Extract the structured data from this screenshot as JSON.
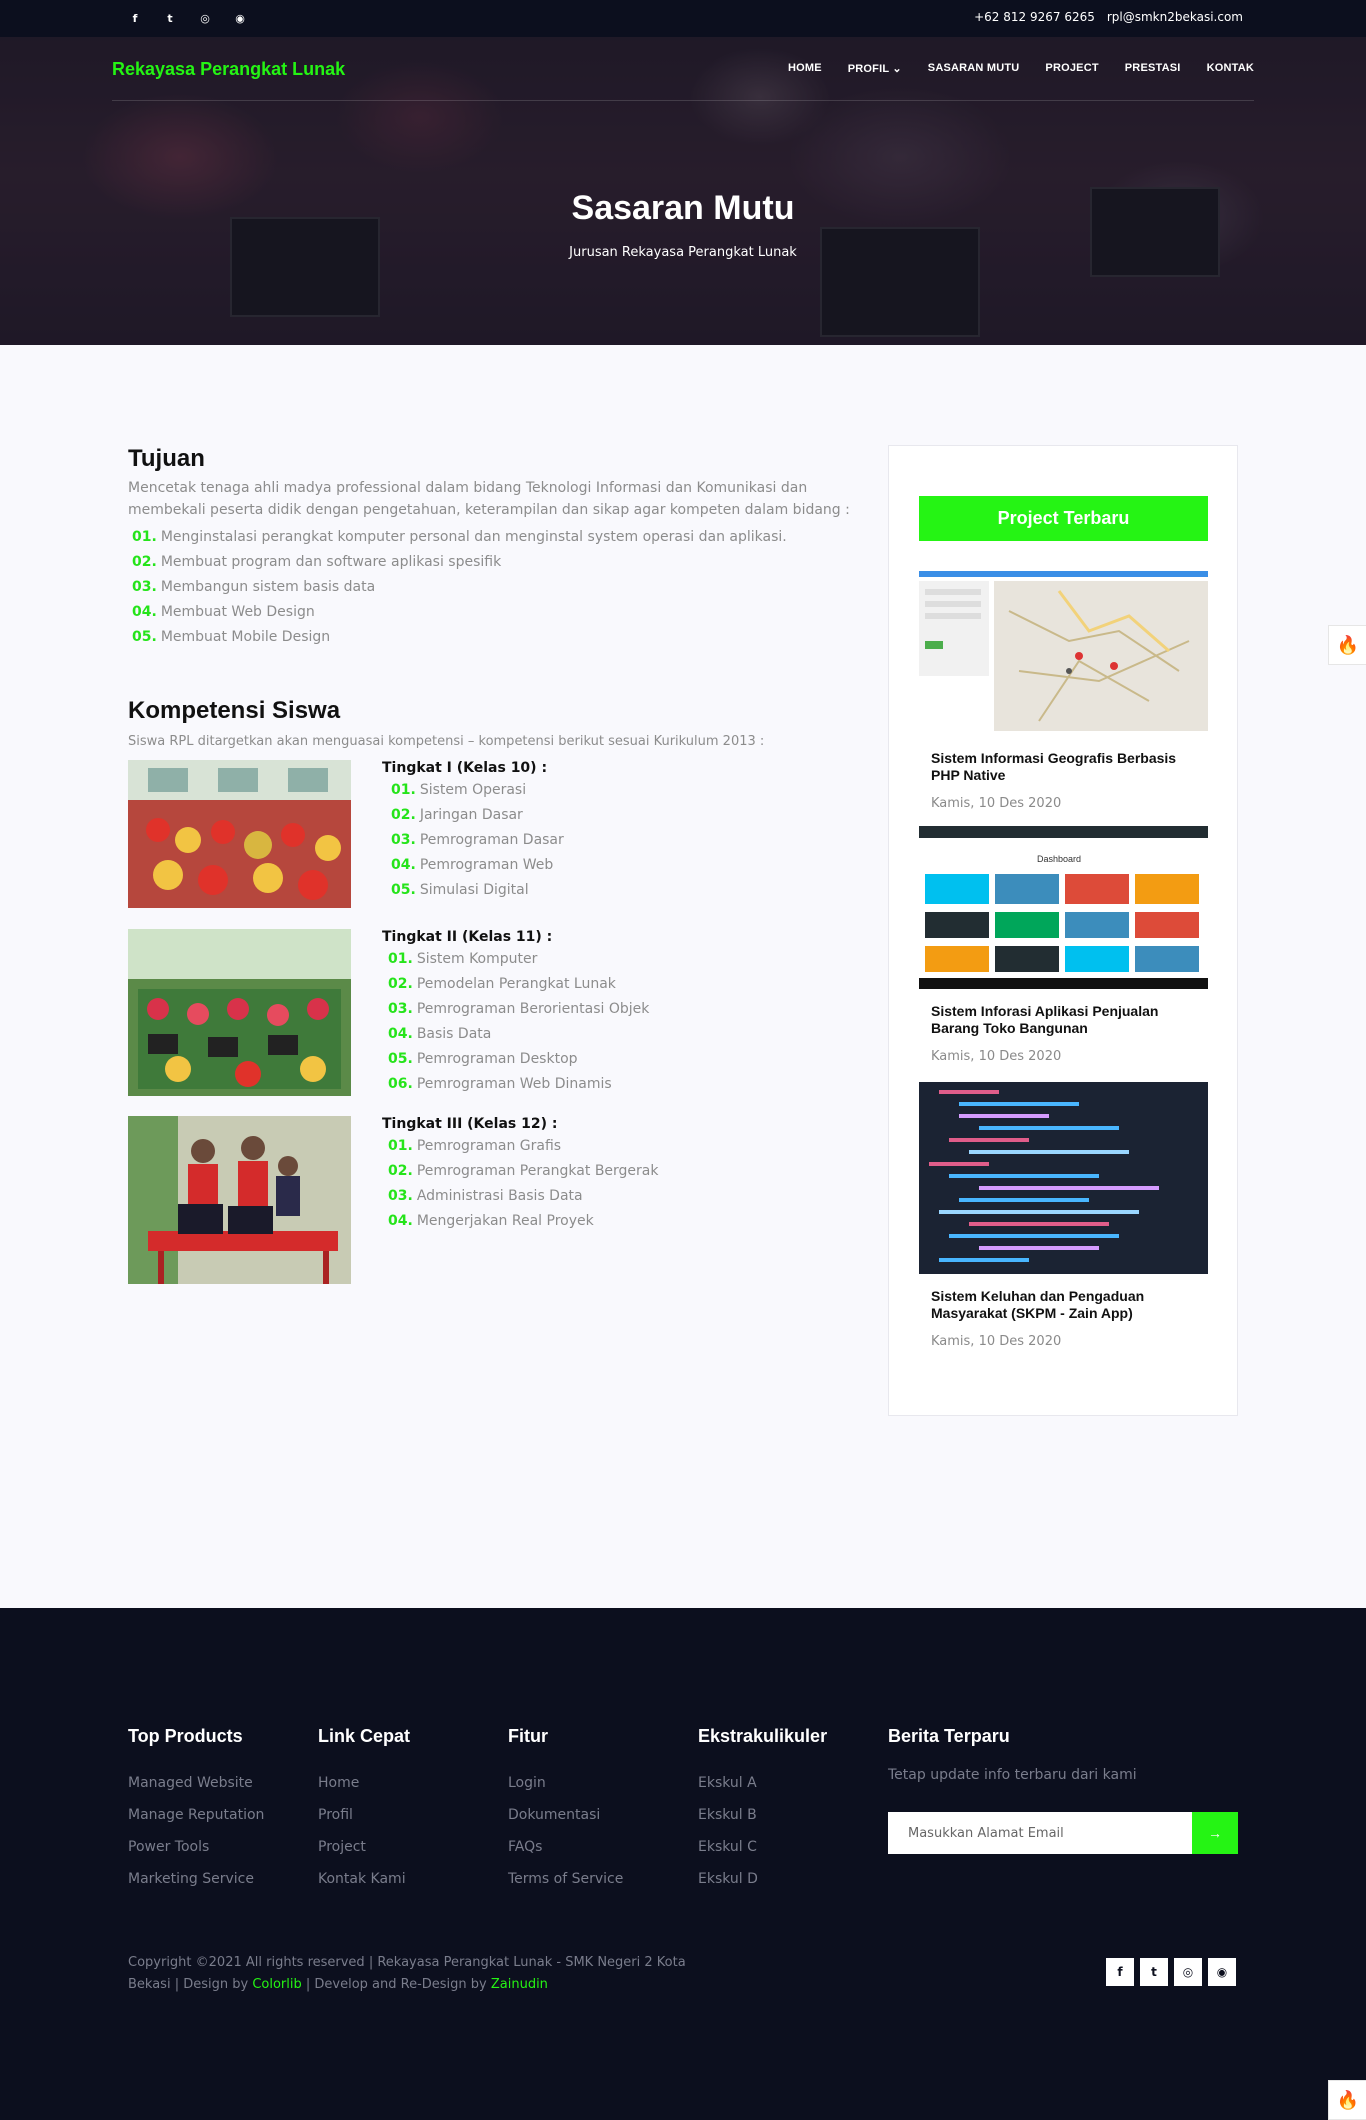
{
  "topbar": {
    "socials": [
      {
        "icon": "facebook-icon",
        "glyph": "f"
      },
      {
        "icon": "twitter-icon",
        "glyph": "t"
      },
      {
        "icon": "instagram-icon",
        "glyph": "◎"
      },
      {
        "icon": "dribbble-icon",
        "glyph": "◉"
      }
    ],
    "phone": "+62 812 9267 6265",
    "email": "rpl@smkn2bekasi.com"
  },
  "nav": {
    "brand": "Rekayasa Perangkat Lunak",
    "links": [
      "HOME",
      "PROFIL",
      "SASARAN MUTU",
      "PROJECT",
      "PRESTASI",
      "KONTAK"
    ],
    "profil_caret": "⌄"
  },
  "hero": {
    "title": "Sasaran Mutu",
    "subtitle": "Jurusan Rekayasa Perangkat Lunak"
  },
  "tujuan": {
    "title": "Tujuan",
    "text": "Mencetak tenaga ahli madya professional dalam bidang Teknologi Informasi dan Komunikasi dan membekali peserta didik dengan pengetahuan, keterampilan dan sikap agar kompeten dalam bidang :",
    "items": [
      {
        "num": "01.",
        "text": "Menginstalasi perangkat komputer personal dan menginstal system operasi dan aplikasi."
      },
      {
        "num": "02.",
        "text": "Membuat program dan software aplikasi spesifik"
      },
      {
        "num": "03.",
        "text": "Membangun sistem basis data"
      },
      {
        "num": "04.",
        "text": "Membuat Web Design"
      },
      {
        "num": "05.",
        "text": "Membuat Mobile Design"
      }
    ]
  },
  "kompetensi": {
    "title": "Kompetensi Siswa",
    "text": "Siswa RPL ditargetkan akan menguasai kompetensi – kompetensi berikut sesuai Kurikulum 2013 :",
    "grades": [
      {
        "head": "Tingkat I (Kelas 10) :",
        "items": [
          {
            "num": "01.",
            "text": "Sistem Operasi"
          },
          {
            "num": "02.",
            "text": "Jaringan Dasar"
          },
          {
            "num": "03.",
            "text": "Pemrograman Dasar"
          },
          {
            "num": "04.",
            "text": "Pemrograman Web"
          },
          {
            "num": "05.",
            "text": "Simulasi Digital"
          }
        ]
      },
      {
        "head": "Tingkat II (Kelas 11) :",
        "items": [
          {
            "num": "01.",
            "text": "Sistem Komputer"
          },
          {
            "num": "02.",
            "text": "Pemodelan Perangkat Lunak"
          },
          {
            "num": "03.",
            "text": "Pemrograman Berorientasi Objek"
          },
          {
            "num": "04.",
            "text": "Basis Data"
          },
          {
            "num": "05.",
            "text": "Pemrograman Desktop"
          },
          {
            "num": "06.",
            "text": "Pemrograman Web Dinamis"
          }
        ]
      },
      {
        "head": "Tingkat III (Kelas 12) :",
        "items": [
          {
            "num": "01.",
            "text": "Pemrograman Grafis"
          },
          {
            "num": "02.",
            "text": "Pemrograman Perangkat Bergerak"
          },
          {
            "num": "03.",
            "text": "Administrasi Basis Data"
          },
          {
            "num": "04.",
            "text": "Mengerjakan Real Proyek"
          }
        ]
      }
    ]
  },
  "sidebar": {
    "title": "Project Terbaru",
    "projects": [
      {
        "title": "Sistem Informasi Geografis Berbasis PHP Native",
        "date": "Kamis, 10 Des 2020"
      },
      {
        "title": "Sistem Inforasi Aplikasi Penjualan Barang Toko Bangunan",
        "date": "Kamis, 10 Des 2020",
        "dashboard_label": "Dashboard"
      },
      {
        "title": "Sistem Keluhan dan Pengaduan Masyarakat (SKPM - Zain App)",
        "date": "Kamis, 10 Des 2020"
      }
    ]
  },
  "footer": {
    "columns": [
      {
        "title": "Top Products",
        "items": [
          "Managed Website",
          "Manage Reputation",
          "Power Tools",
          "Marketing Service"
        ]
      },
      {
        "title": "Link Cepat",
        "items": [
          "Home",
          "Profil",
          "Project",
          "Kontak Kami"
        ]
      },
      {
        "title": "Fitur",
        "items": [
          "Login",
          "Dokumentasi",
          "FAQs",
          "Terms of Service"
        ]
      },
      {
        "title": "Ekstrakulikuler",
        "items": [
          "Ekskul A",
          "Ekskul B",
          "Ekskul C",
          "Ekskul D"
        ]
      }
    ],
    "newsletter": {
      "title": "Berita Terparu",
      "text": "Tetap update info terbaru dari kami",
      "placeholder": "Masukkan Alamat Email",
      "button_glyph": "→"
    },
    "copyright": {
      "before": "Copyright ©2021 All rights reserved | Rekayasa Perangkat Lunak - SMK Negeri 2 Kota Bekasi | Design by ",
      "colorlib": "Colorlib",
      "middle": " | Develop and Re-Design by ",
      "author": "Zainudin"
    }
  },
  "colors": {
    "accent": "#25f414",
    "dark": "#0c0f1e"
  },
  "fire_icon": "🔥"
}
